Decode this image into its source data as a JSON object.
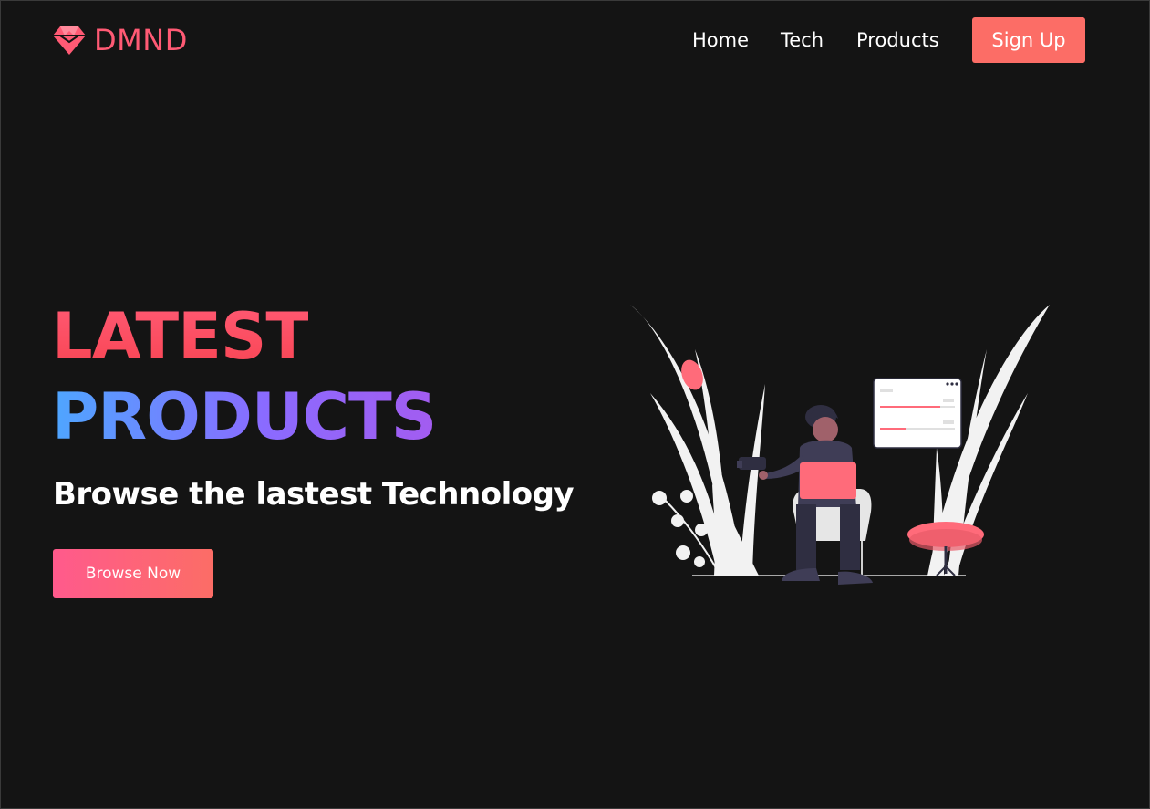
{
  "brand": {
    "name": "DMND",
    "logo_icon": "diamond-icon"
  },
  "nav": {
    "items": [
      {
        "label": "Home"
      },
      {
        "label": "Tech"
      },
      {
        "label": "Products"
      }
    ],
    "cta_label": "Sign Up"
  },
  "hero": {
    "title_line1": "LATEST",
    "title_line2": "PRODUCTS",
    "subtitle": "Browse the lastest Technology",
    "button_label": "Browse Now"
  },
  "colors": {
    "background": "#141414",
    "brand": "#ff5a74",
    "accent": "#fc6d66",
    "gradient_blue": "#4ea6ff",
    "gradient_purple": "#a35cf0"
  },
  "illustration": {
    "icon": "person-with-laptop-illustration"
  }
}
